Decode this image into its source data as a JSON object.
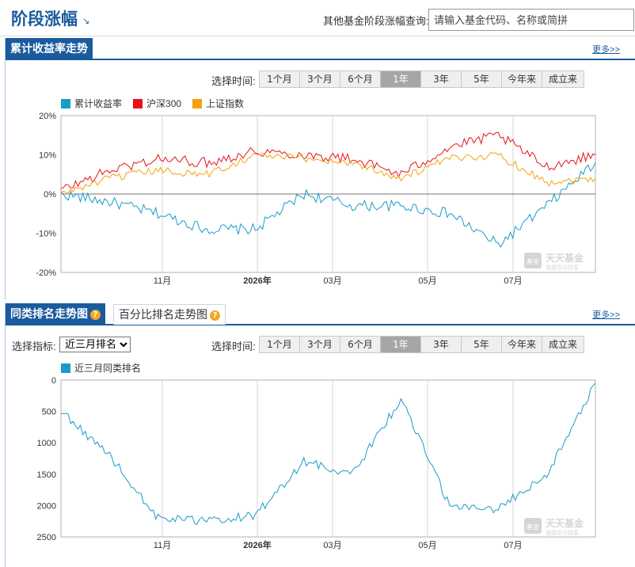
{
  "header": {
    "title": "阶段涨幅",
    "query_label": "其他基金阶段涨幅查询:",
    "search_placeholder": "请输入基金代码、名称或简拼"
  },
  "section1": {
    "tab": "累计收益率走势",
    "more": "更多>>",
    "period_label": "选择时间:",
    "periods": [
      "1个月",
      "3个月",
      "6个月",
      "1年",
      "3年",
      "5年",
      "今年来",
      "成立来"
    ],
    "active_period": "1年",
    "legend": [
      "累计收益率",
      "沪深300",
      "上证指数"
    ]
  },
  "section2": {
    "tab_active": "同类排名走势图",
    "tab_inactive": "百分比排名走势图",
    "more": "更多>>",
    "indicator_label": "选择指标:",
    "indicator_value": "近三月排名",
    "period_label": "选择时间:",
    "periods": [
      "1个月",
      "3个月",
      "6个月",
      "1年",
      "3年",
      "5年",
      "今年来",
      "成立来"
    ],
    "active_period": "1年",
    "legend": [
      "近三月同类排名"
    ]
  },
  "watermark": {
    "logo": "天天基金",
    "sub": "链接您与财富",
    "badge": "基金"
  },
  "colors": {
    "fund": "#1a9bc8",
    "hs300": "#e8121c",
    "sh": "#f5a20a",
    "brand": "#1a5b9e"
  },
  "chart_data": [
    {
      "type": "line",
      "title": "累计收益率走势",
      "ylabel": "",
      "y_unit": "%",
      "ylim": [
        -20,
        20
      ],
      "y_ticks": [
        "20%",
        "10%",
        "0%",
        "-10%",
        "-20%"
      ],
      "x_ticks": [
        "11月",
        "2026年",
        "03月",
        "05月",
        "07月"
      ],
      "x_range": [
        "2025-09",
        "2026-08"
      ],
      "x": [
        "2025-09",
        "2025-10",
        "2025-11",
        "2025-12",
        "2026-01",
        "2026-02",
        "2026-03",
        "2026-04",
        "2026-05",
        "2026-06",
        "2026-07",
        "2026-08"
      ],
      "series": [
        {
          "name": "累计收益率",
          "values": [
            0,
            -2,
            -5,
            -9,
            -9,
            0,
            -3,
            -3,
            -5,
            -13,
            -3,
            8
          ]
        },
        {
          "name": "沪深300",
          "values": [
            1,
            6,
            9,
            8,
            11,
            10,
            9,
            5,
            12,
            15,
            7,
            10
          ]
        },
        {
          "name": "上证指数",
          "values": [
            0,
            4,
            6,
            5,
            10,
            9,
            8,
            4,
            9,
            10,
            3,
            4
          ]
        }
      ]
    },
    {
      "type": "line",
      "title": "同类排名走势图",
      "ylabel": "",
      "ylim": [
        0,
        2500
      ],
      "y_inverted": true,
      "y_ticks": [
        "0",
        "500",
        "1000",
        "1500",
        "2000",
        "2500"
      ],
      "x_ticks": [
        "11月",
        "2026年",
        "03月",
        "05月",
        "07月"
      ],
      "x": [
        "2025-09",
        "2025-10",
        "2025-11",
        "2025-12",
        "2026-01",
        "2026-02",
        "2026-03",
        "2026-04",
        "2026-05",
        "2026-06",
        "2026-07",
        "2026-08"
      ],
      "series": [
        {
          "name": "近三月同类排名",
          "values": [
            500,
            1200,
            2200,
            2250,
            2150,
            1300,
            1500,
            300,
            2000,
            2050,
            1500,
            50
          ]
        }
      ]
    }
  ]
}
